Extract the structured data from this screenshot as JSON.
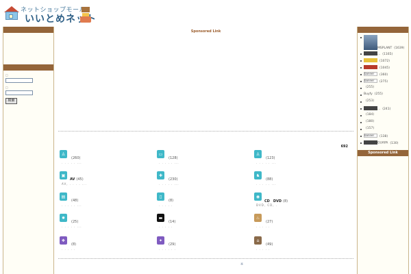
{
  "header": {
    "subtitle": "ネットショップモール",
    "title": "いいとめネット"
  },
  "main": {
    "sponsored_label": "Sponsored Link",
    "total_count": "692",
    "footer_mark": "※",
    "categories": [
      {
        "icon": "shirt-icon",
        "color": "#3fb8c8",
        "glyph": "♙",
        "name": "",
        "count": "(260)",
        "sub": ". . . . . ..."
      },
      {
        "icon": "ticket-icon",
        "color": "#3fb8c8",
        "glyph": "▭",
        "name": "",
        "count": "(128)",
        "sub": ". . . . . ..."
      },
      {
        "icon": "person-icon",
        "color": "#3fb8c8",
        "glyph": "♙",
        "name": "",
        "count": "(123)",
        "sub": ". . . . . ..."
      },
      {
        "icon": "monitor-icon",
        "color": "#3fb8c8",
        "glyph": "▣",
        "name": "AV",
        "count": "(45)",
        "sub": "AV, . . . . ..."
      },
      {
        "icon": "tool-icon",
        "color": "#3fb8c8",
        "glyph": "✚",
        "name": "",
        "count": "(230)",
        "sub": ". . . . . ..."
      },
      {
        "icon": "animal-icon",
        "color": "#3fb8c8",
        "glyph": "♞",
        "name": "",
        "count": "(88)",
        "sub": ". . . . . ..."
      },
      {
        "icon": "book-icon",
        "color": "#3fb8c8",
        "glyph": "▤",
        "name": "",
        "count": "(48)",
        "sub": ". . . . . ..."
      },
      {
        "icon": "phone-icon",
        "color": "#3fb8c8",
        "glyph": "▯",
        "name": "",
        "count": "(8)",
        "sub": ". . . . ."
      },
      {
        "icon": "disc-icon",
        "color": "#3fb8c8",
        "glyph": "◉",
        "name": "CD　DVD",
        "count": "(8)",
        "sub": "DVD, CD, ."
      },
      {
        "icon": "gear-icon",
        "color": "#3fb8c8",
        "glyph": "✹",
        "name": "",
        "count": "(25)",
        "sub": ". . . . . ..."
      },
      {
        "icon": "car-icon",
        "color": "#111111",
        "glyph": "▬",
        "name": "",
        "count": "(14)",
        "sub": ". . . . ."
      },
      {
        "icon": "food-icon",
        "color": "#c79a5a",
        "glyph": "♨",
        "name": "",
        "count": "(27)",
        "sub": ". . . . ."
      },
      {
        "icon": "gift-icon",
        "color": "#7f5bc0",
        "glyph": "❖",
        "name": "",
        "count": "(8)",
        "sub": ". . . . ."
      },
      {
        "icon": "game-icon",
        "color": "#7f5bc0",
        "glyph": "✦",
        "name": "",
        "count": "(29)",
        "sub": ". . . . . ."
      },
      {
        "icon": "house-icon",
        "color": "#8a6a4a",
        "glyph": "⌂",
        "name": "",
        "count": "(49)",
        "sub": ". . . . ."
      }
    ]
  },
  "left": {
    "label1": "□",
    "label2": "□",
    "submit_label": "検索"
  },
  "right": {
    "sponsored_label": "Sponsored Link",
    "items": [
      {
        "kind": "avatar",
        "label": "MSPLANT",
        "count": "(1639)"
      },
      {
        "kind": "dark",
        "label": "...",
        "count": "(1165)"
      },
      {
        "kind": "yel",
        "label": "",
        "count": "(1072)"
      },
      {
        "kind": "red",
        "label": "",
        "count": "(1045)"
      },
      {
        "kind": "box",
        "label": "banner",
        "count": "(360)"
      },
      {
        "kind": "box",
        "label": "banner",
        "count": "(275)"
      },
      {
        "kind": "text",
        "label": "",
        "count": "(255)"
      },
      {
        "kind": "text",
        "label": "Buyfy",
        "count": "(255)"
      },
      {
        "kind": "text",
        "label": "",
        "count": "(253)"
      },
      {
        "kind": "dark",
        "label": "...",
        "count": "(241)"
      },
      {
        "kind": "text",
        "label": "",
        "count": "(184)"
      },
      {
        "kind": "text",
        "label": "",
        "count": "(180)"
      },
      {
        "kind": "text",
        "label": "",
        "count": "(157)"
      },
      {
        "kind": "box",
        "label": "banner",
        "count": "(138)"
      },
      {
        "kind": "dark",
        "label": "GUAPA",
        "count": "(130)"
      }
    ]
  }
}
